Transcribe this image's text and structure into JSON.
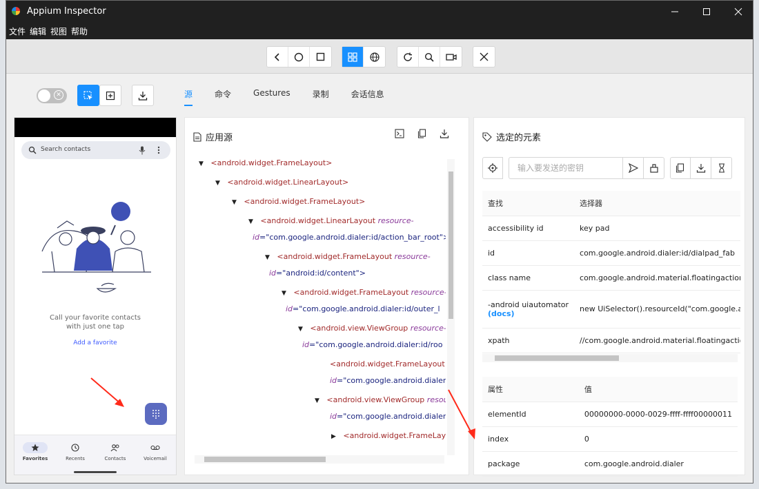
{
  "window": {
    "title": "Appium Inspector"
  },
  "menu": [
    "文件",
    "编辑",
    "视图",
    "帮助"
  ],
  "toolbar": {
    "nav_icons": [
      "back-icon",
      "home-icon",
      "recents-icon"
    ],
    "mode_icons": [
      "native-mode-icon",
      "web-mode-icon"
    ],
    "action_icons": [
      "refresh-icon",
      "search-icon",
      "record-icon"
    ],
    "quit_icon": "close-icon"
  },
  "tabs": [
    "源",
    "命令",
    "Gestures",
    "录制",
    "会话信息"
  ],
  "active_tab": 0,
  "device": {
    "search_placeholder": "Search contacts",
    "empty_line1": "Call your favorite contacts",
    "empty_line2": "with just one tap",
    "add_favorite": "Add a favorite",
    "nav": [
      "Favorites",
      "Recents",
      "Contacts",
      "Voicemail"
    ]
  },
  "source_panel": {
    "title": "应用源",
    "tree": [
      {
        "caret": "▼",
        "tag": "<android.widget.FrameLayout>"
      },
      {
        "caret": "▼",
        "tag": "<android.widget.LinearLayout>"
      },
      {
        "caret": "▼",
        "tag": "<android.widget.FrameLayout>"
      },
      {
        "caret": "▼",
        "tag": "<android.widget.LinearLayout",
        "attr": "resource-",
        "line2_attr": "id",
        "line2_val": "=\"com.google.android.dialer:id/action_bar_root\">"
      },
      {
        "caret": "▼",
        "tag": "<android.widget.FrameLayout",
        "attr": "resource-",
        "line2_attr": "id",
        "line2_val": "=\"android:id/content\">"
      },
      {
        "caret": "▼",
        "tag": "<android.widget.FrameLayout",
        "attr": "resource-",
        "line2_attr": "id",
        "line2_val": "=\"com.google.android.dialer:id/outer_l"
      },
      {
        "caret": "▼",
        "tag": "<android.view.ViewGroup",
        "attr": "resource-",
        "line2_attr": "id",
        "line2_val": "=\"com.google.android.dialer:id/roo"
      },
      {
        "caret": "",
        "tag": "<android.widget.FrameLayout",
        "attr": "r",
        "line2_attr": "id",
        "line2_val": "=\"com.google.android.dialer:i"
      },
      {
        "caret": "▼",
        "tag": "<android.view.ViewGroup",
        "attr": "resou",
        "line2_attr": "id",
        "line2_val": "=\"com.google.android.dialer:i"
      },
      {
        "caret": "▶",
        "tag": "<android.widget.FrameLayo",
        "attr": "",
        "line2_attr": "",
        "line2_val": ""
      }
    ]
  },
  "selected_panel": {
    "title": "选定的元素",
    "key_placeholder": "输入要发送的密钥",
    "find_header": [
      "查找",
      "选择器"
    ],
    "find_rows": [
      {
        "strategy": "accessibility id",
        "selector": "key pad"
      },
      {
        "strategy": "id",
        "selector": "com.google.android.dialer:id/dialpad_fab"
      },
      {
        "strategy": "class name",
        "selector": "com.google.android.material.floatingactionl"
      },
      {
        "strategy": "-android uiautomator",
        "docs": "(docs)",
        "selector": "new UiSelector().resourceId(\"com.google.an"
      },
      {
        "strategy": "xpath",
        "selector": "//com.google.android.material.floatingactio"
      }
    ],
    "attr_header": [
      "属性",
      "值"
    ],
    "attr_rows": [
      {
        "name": "elementId",
        "value": "00000000-0000-0029-ffff-ffff00000011"
      },
      {
        "name": "index",
        "value": "0"
      },
      {
        "name": "package",
        "value": "com.google.android.dialer"
      }
    ]
  },
  "accent": "#1890ff",
  "annotation_color": "#ff2a1a"
}
